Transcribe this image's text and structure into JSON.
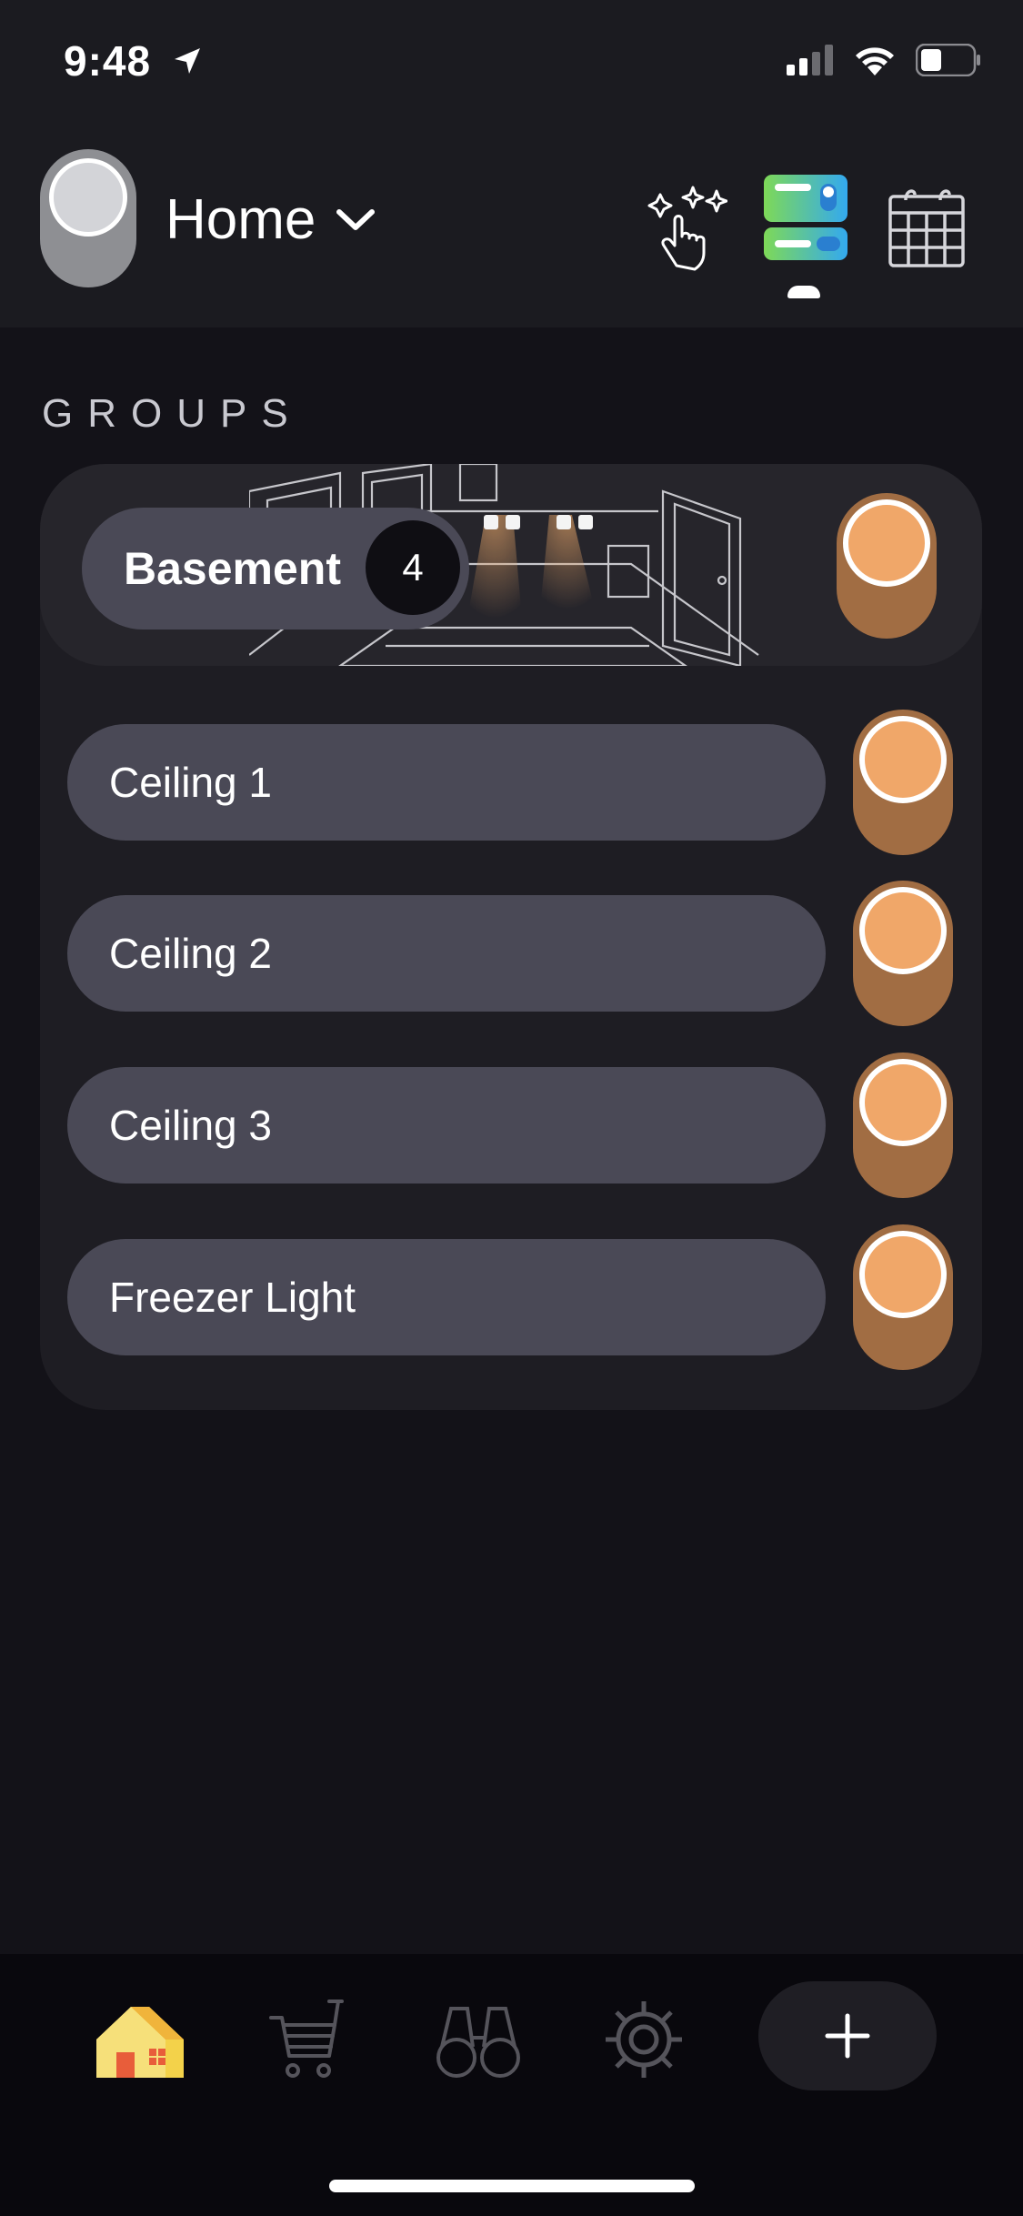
{
  "status": {
    "time": "9:48"
  },
  "header": {
    "home_title": "Home",
    "icons": [
      "sparkle-tap-icon",
      "device-list-icon",
      "calendar-icon"
    ]
  },
  "section": {
    "label": "GROUPS"
  },
  "group": {
    "name": "Basement",
    "count": "4",
    "on": true
  },
  "lights": [
    {
      "label": "Ceiling 1",
      "on": true
    },
    {
      "label": "Ceiling 2",
      "on": true
    },
    {
      "label": "Ceiling 3",
      "on": true
    },
    {
      "label": "Freezer Light",
      "on": true
    }
  ],
  "tabbar": {
    "tabs": [
      "home-icon",
      "cart-icon",
      "binoculars-icon",
      "gear-icon"
    ],
    "add": "+"
  },
  "colors": {
    "toggle_track": "#a16d43",
    "toggle_knob": "#f0a769",
    "pill": "#4a4956",
    "background": "#131218"
  }
}
